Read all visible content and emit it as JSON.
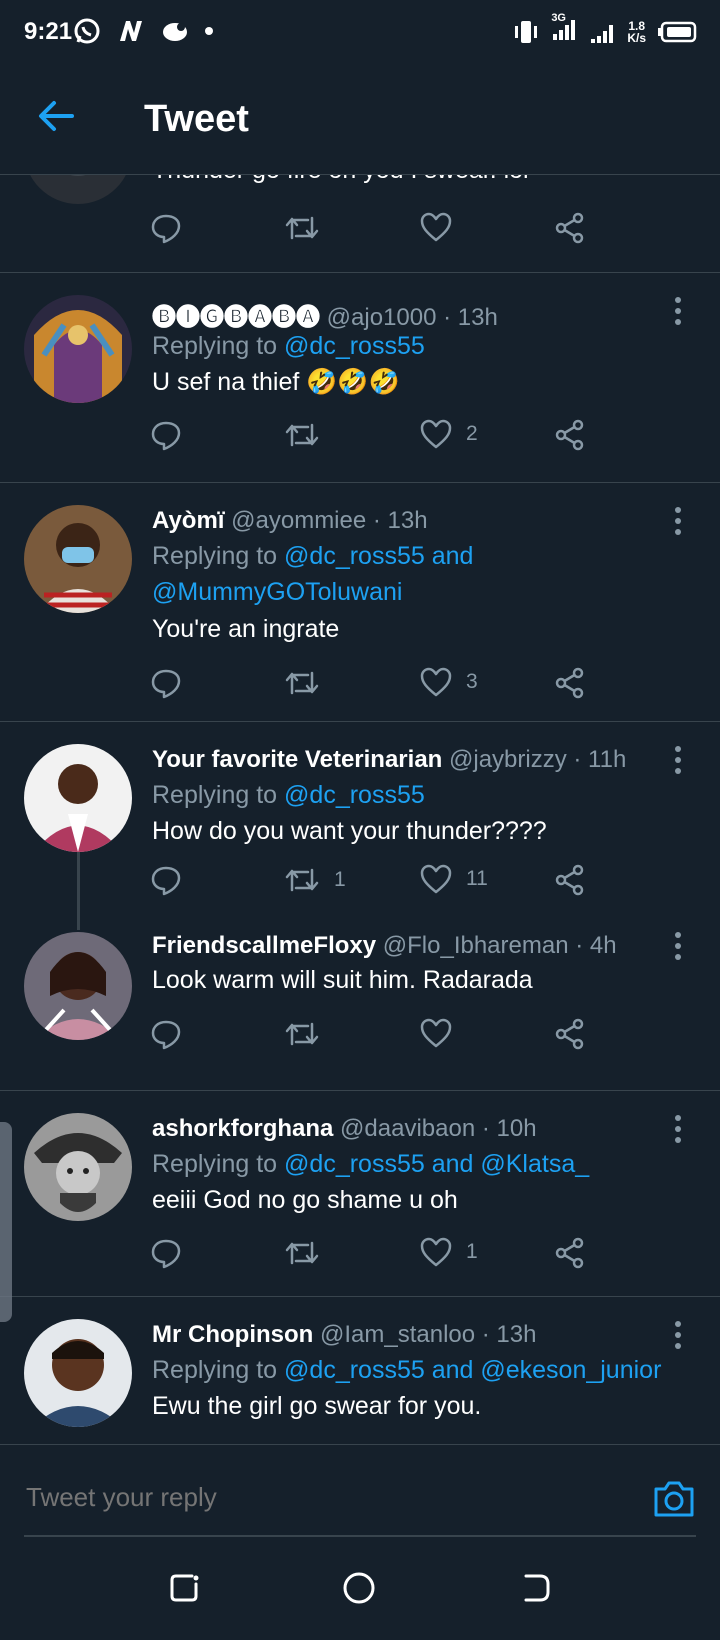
{
  "status_bar": {
    "time": "9:21",
    "network": "3G",
    "speed_value": "1.8",
    "speed_unit": "K/s"
  },
  "header": {
    "title": "Tweet"
  },
  "partial_tweet": {
    "text": "Thunder go fire on you I swear. lol"
  },
  "tweets": [
    {
      "name": "🅑🅘🅖🅑🅐🅑🅐",
      "handle": "@ajo1000",
      "time": "· 13h",
      "replying_prefix": "Replying to",
      "replying_to": "@dc_ross55",
      "text": "U sef na thief 🤣🤣🤣",
      "retweets": "",
      "likes": "2"
    },
    {
      "name": "Ayòmï",
      "handle": "@ayommiee",
      "time": "· 13h",
      "replying_prefix": "Replying to",
      "replying_to": "@dc_ross55 and",
      "replying_to_2": "@MummyGOToluwani",
      "text": "You're an ingrate",
      "retweets": "",
      "likes": "3"
    },
    {
      "name": "Your favorite Veterinarian",
      "handle": "@jaybrizzy",
      "time": "· 11h",
      "replying_prefix": "Replying to",
      "replying_to": "@dc_ross55",
      "text": "How do you want your thunder????",
      "retweets": "1",
      "likes": "11"
    },
    {
      "name": "FriendscallmeFloxy",
      "handle": "@Flo_Ibhareman",
      "time": "· 4h",
      "text": "Look warm will suit him. Radarada",
      "retweets": "",
      "likes": ""
    },
    {
      "name": "ashorkforghana",
      "handle": "@daavibaon",
      "time": "· 10h",
      "replying_prefix": "Replying to",
      "replying_to": "@dc_ross55 and @Klatsa_",
      "text": "eeiii God no go shame u oh",
      "retweets": "",
      "likes": "1"
    },
    {
      "name": "Mr Chopinson",
      "handle": "@Iam_stanloo",
      "time": "· 13h",
      "replying_prefix": "Replying to",
      "replying_to": "@dc_ross55 and @ekeson_junior",
      "text": "Ewu the girl go swear for you."
    }
  ],
  "reply_box": {
    "placeholder": "Tweet your reply"
  },
  "colors": {
    "background": "#15202b",
    "accent": "#1da1f2",
    "secondary_text": "#8899a6",
    "divider": "#38444d"
  }
}
